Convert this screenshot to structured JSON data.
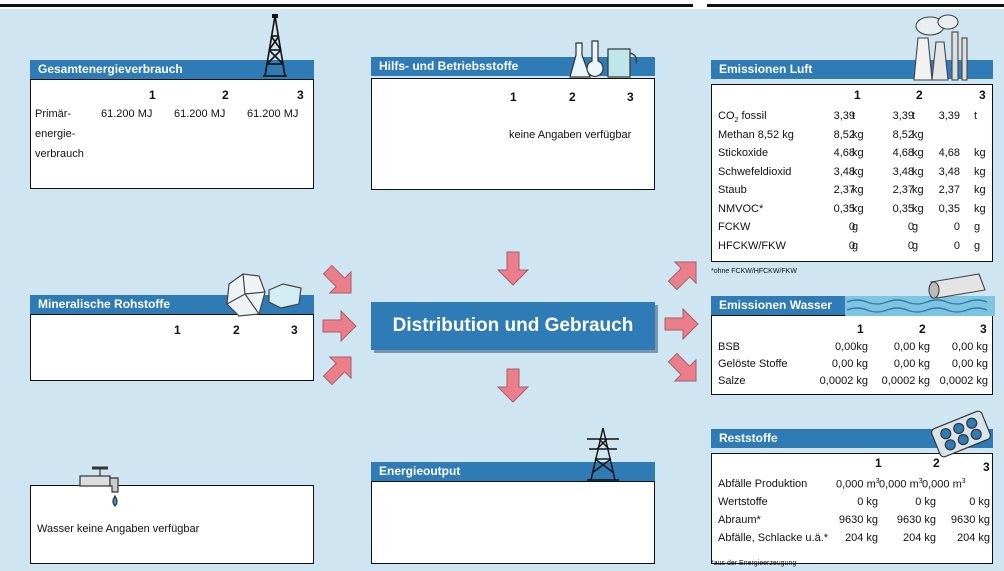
{
  "center": {
    "title": "Distribution und Gebrauch"
  },
  "gesamt": {
    "title": "Gesamtenergieverbrauch",
    "cols": [
      "1",
      "2",
      "3"
    ],
    "label_lines": [
      "Primär-",
      "energie-",
      "verbrauch"
    ],
    "values": [
      "61.200 MJ",
      "61.200 MJ",
      "61.200 MJ"
    ]
  },
  "hilfs": {
    "title": "Hilfs- und Betriebsstoffe",
    "cols": [
      "1",
      "2",
      "3"
    ],
    "note": "keine Angaben verfügbar"
  },
  "mineral": {
    "title": "Mineralische Rohstoffe",
    "cols": [
      "1",
      "2",
      "3"
    ]
  },
  "wasser": {
    "text": "Wasser keine Angaben verfügbar"
  },
  "energieoutput": {
    "title": "Energieoutput"
  },
  "luft": {
    "title": "Emissionen Luft",
    "cols": [
      "1",
      "2",
      "3"
    ],
    "co2_label": "CO",
    "co2_sub": "2",
    "co2_suffix": " fossil",
    "rows": [
      {
        "label": "",
        "v": [
          "3,39",
          "3,39",
          "3,39"
        ],
        "u": [
          "t",
          "t",
          "t"
        ]
      },
      {
        "label": "Methan 8,52 kg",
        "v": [
          "8,52",
          "8,52",
          ""
        ],
        "u": [
          "kg",
          "kg",
          ""
        ]
      },
      {
        "label": "Stickoxide",
        "v": [
          "4,68",
          "4,68",
          "4,68"
        ],
        "u": [
          "kg",
          "kg",
          "kg"
        ]
      },
      {
        "label": "Schwefeldioxid",
        "v": [
          "3,48",
          "3,48",
          "3,48"
        ],
        "u": [
          "kg",
          "kg",
          "kg"
        ]
      },
      {
        "label": "Staub",
        "v": [
          "2,37",
          "2,37",
          "2,37"
        ],
        "u": [
          "kg",
          "kg",
          "kg"
        ]
      },
      {
        "label": "NMVOC*",
        "v": [
          "0,35",
          "0,35",
          "0,35"
        ],
        "u": [
          "kg",
          "kg",
          "kg"
        ]
      },
      {
        "label": "FCKW",
        "v": [
          "0",
          "0",
          "0"
        ],
        "u": [
          "g",
          "g",
          "g"
        ]
      },
      {
        "label": "HFCKW/FKW",
        "v": [
          "0",
          "0",
          "0"
        ],
        "u": [
          "g",
          "g",
          "g"
        ]
      }
    ],
    "footnote": "*ohne FCKW/HFCKW/FKW"
  },
  "wasser_em": {
    "title": "Emissionen Wasser",
    "cols": [
      "1",
      "2",
      "3"
    ],
    "rows": [
      {
        "label": "BSB",
        "v": [
          "0,00kg",
          "0,00 kg",
          "0,00 kg"
        ]
      },
      {
        "label": "Gelöste Stoffe",
        "v": [
          "0,00 kg",
          "0,00 kg",
          "0,00 kg"
        ]
      },
      {
        "label": "Salze",
        "v": [
          "0,0002 kg",
          "0,0002 kg",
          "0,0002 kg"
        ]
      }
    ]
  },
  "rest": {
    "title": "Reststoffe",
    "cols": [
      "1",
      "2",
      "3"
    ],
    "row1_label": "Abfälle Produktion",
    "row1_vals": [
      "0,000 m",
      "0,000 m",
      "0,000 m"
    ],
    "row1_sup": "3",
    "rows": [
      {
        "label": "Wertstoffe",
        "v": [
          "0 kg",
          "0 kg",
          "0 kg"
        ]
      },
      {
        "label": "Abraum*",
        "v": [
          "9630 kg",
          "9630 kg",
          "9630 kg"
        ]
      },
      {
        "label": "Abfälle, Schlacke u.ä.*",
        "v": [
          "204 kg",
          "204 kg",
          "204 kg"
        ]
      }
    ],
    "footnote": "*aus der Energieerzeugung"
  },
  "colors": {
    "header": "#2e7bb5",
    "background": "#cfe5f2",
    "arrow": "#ec7e8a"
  }
}
